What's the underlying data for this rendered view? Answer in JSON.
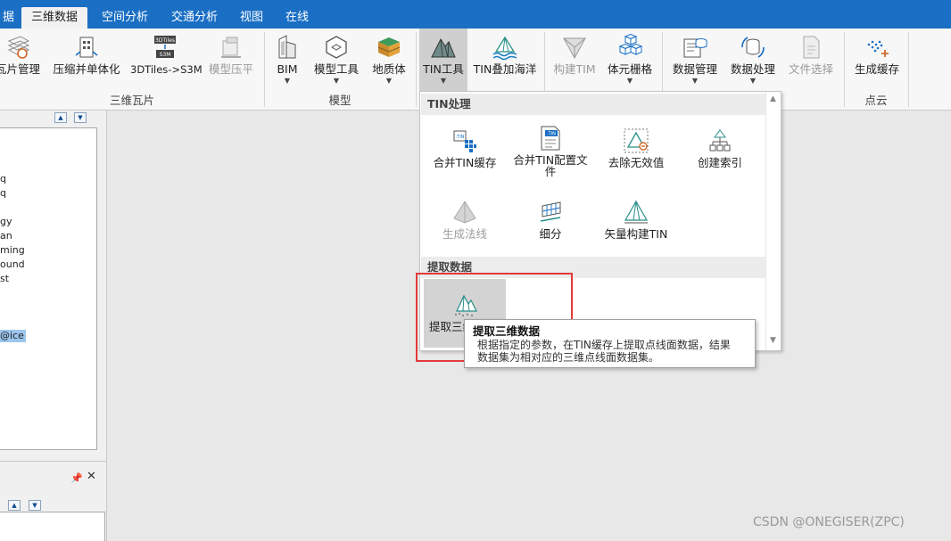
{
  "menubar": {
    "items": [
      "据",
      "三维数据",
      "空间分析",
      "交通分析",
      "视图",
      "在线"
    ],
    "active_index": 1
  },
  "ribbon": {
    "buttons": [
      {
        "label": "瓦片管理",
        "icon": "tile-grid-icon",
        "disabled": false
      },
      {
        "label": "压缩并单体化",
        "icon": "compress-building-icon",
        "disabled": false
      },
      {
        "label": "3DTiles->S3M",
        "icon": "tiles-to-s3m-icon",
        "badge_top": "3DTiles",
        "badge_bottom": "S3M",
        "disabled": false
      },
      {
        "label": "模型压平",
        "icon": "model-flatten-icon",
        "disabled": true
      },
      {
        "label": "BIM",
        "icon": "bim-building-icon",
        "disabled": false
      },
      {
        "label": "模型工具",
        "icon": "model-tool-icon",
        "disabled": false
      },
      {
        "label": "地质体",
        "icon": "geology-layers-icon",
        "disabled": false
      },
      {
        "label": "TIN工具",
        "icon": "tin-mountain-icon",
        "disabled": false
      },
      {
        "label": "TIN叠加海洋",
        "icon": "tin-ocean-icon",
        "disabled": false
      },
      {
        "label": "构建TIM",
        "icon": "build-tim-icon",
        "disabled": true
      },
      {
        "label": "体元栅格",
        "icon": "voxel-grid-icon",
        "disabled": false
      },
      {
        "label": "数据管理",
        "icon": "data-manage-icon",
        "disabled": false
      },
      {
        "label": "数据处理",
        "icon": "data-process-icon",
        "disabled": false
      },
      {
        "label": "文件选择",
        "icon": "file-select-icon",
        "disabled": true
      },
      {
        "label": "生成缓存",
        "icon": "point-cloud-cache-icon",
        "disabled": false
      }
    ],
    "groups": [
      "三维瓦片",
      "模型",
      "点云"
    ]
  },
  "left_panel": {
    "tree_items": [
      "q",
      "q",
      "gy",
      "an",
      "ming",
      "ound",
      "st",
      "@ice"
    ],
    "selected_index": 7
  },
  "dropdown": {
    "sections": [
      {
        "header": "TIN处理",
        "items": [
          {
            "label": "合并TIN缓存",
            "icon": "merge-tin-cache-icon",
            "disabled": false
          },
          {
            "label": "合并TIN配置文件",
            "icon": "tin-config-file-icon",
            "badge": ".TIN",
            "disabled": false
          },
          {
            "label": "去除无效值",
            "icon": "remove-invalid-icon",
            "disabled": false
          },
          {
            "label": "创建索引",
            "icon": "create-index-icon",
            "disabled": false
          },
          {
            "label": "生成法线",
            "icon": "generate-normals-icon",
            "disabled": true
          },
          {
            "label": "细分",
            "icon": "subdivide-icon",
            "disabled": false
          },
          {
            "label": "矢量构建TIN",
            "icon": "vector-build-tin-icon",
            "disabled": false
          }
        ]
      },
      {
        "header": "提取数据",
        "items": [
          {
            "label": "提取三维数据",
            "icon": "extract-3d-data-icon",
            "disabled": false
          }
        ]
      }
    ]
  },
  "tooltip": {
    "title": "提取三维数据",
    "desc_line1": "根据指定的参数，在TIN缓存上提取点线面数据，结果",
    "desc_line2": "数据集为相对应的三维点线面数据集。"
  },
  "watermark": "CSDN @ONEGISER(ZPC)",
  "colors": {
    "menubar_bg": "#1a6fc4",
    "highlight_box": "#e23a3a",
    "selection": "#9cc6ee"
  }
}
